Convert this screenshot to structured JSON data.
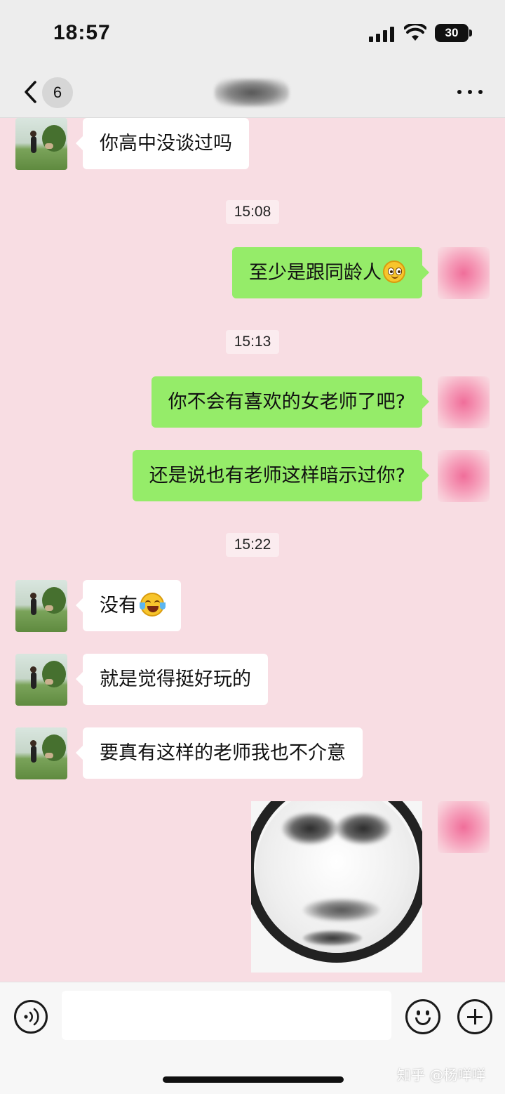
{
  "status_bar": {
    "time": "18:57",
    "battery": "30"
  },
  "nav": {
    "unread_count": "6",
    "more_icon": "more-icon",
    "back_icon": "chevron-left-icon"
  },
  "messages": [
    {
      "side": "left",
      "text": "你高中没谈过吗"
    },
    {
      "type": "time",
      "text": "15:08"
    },
    {
      "side": "right",
      "text": "至少是跟同龄人",
      "emoji": "smiling-face-icon"
    },
    {
      "type": "time",
      "text": "15:13"
    },
    {
      "side": "right",
      "text": "你不会有喜欢的女老师了吧?"
    },
    {
      "side": "right",
      "text": "还是说也有老师这样暗示过你?"
    },
    {
      "type": "time",
      "text": "15:22"
    },
    {
      "side": "left",
      "text": "没有",
      "emoji": "laughing-tears-icon"
    },
    {
      "side": "left",
      "text": "就是觉得挺好玩的"
    },
    {
      "side": "left",
      "text": "要真有这样的老师我也不介意"
    },
    {
      "side": "right",
      "type": "sticker",
      "icon": "face-sticker-image"
    }
  ],
  "input_bar": {
    "value": "",
    "voice_icon": "voice-icon",
    "emoji_icon": "emoji-icon",
    "plus_icon": "plus-icon"
  },
  "watermark": "知乎 @杨咩咩",
  "colors": {
    "chat_background": "#f8dde3",
    "sent_bubble": "#95ec69",
    "received_bubble": "#ffffff",
    "bar_background": "#ededed"
  }
}
